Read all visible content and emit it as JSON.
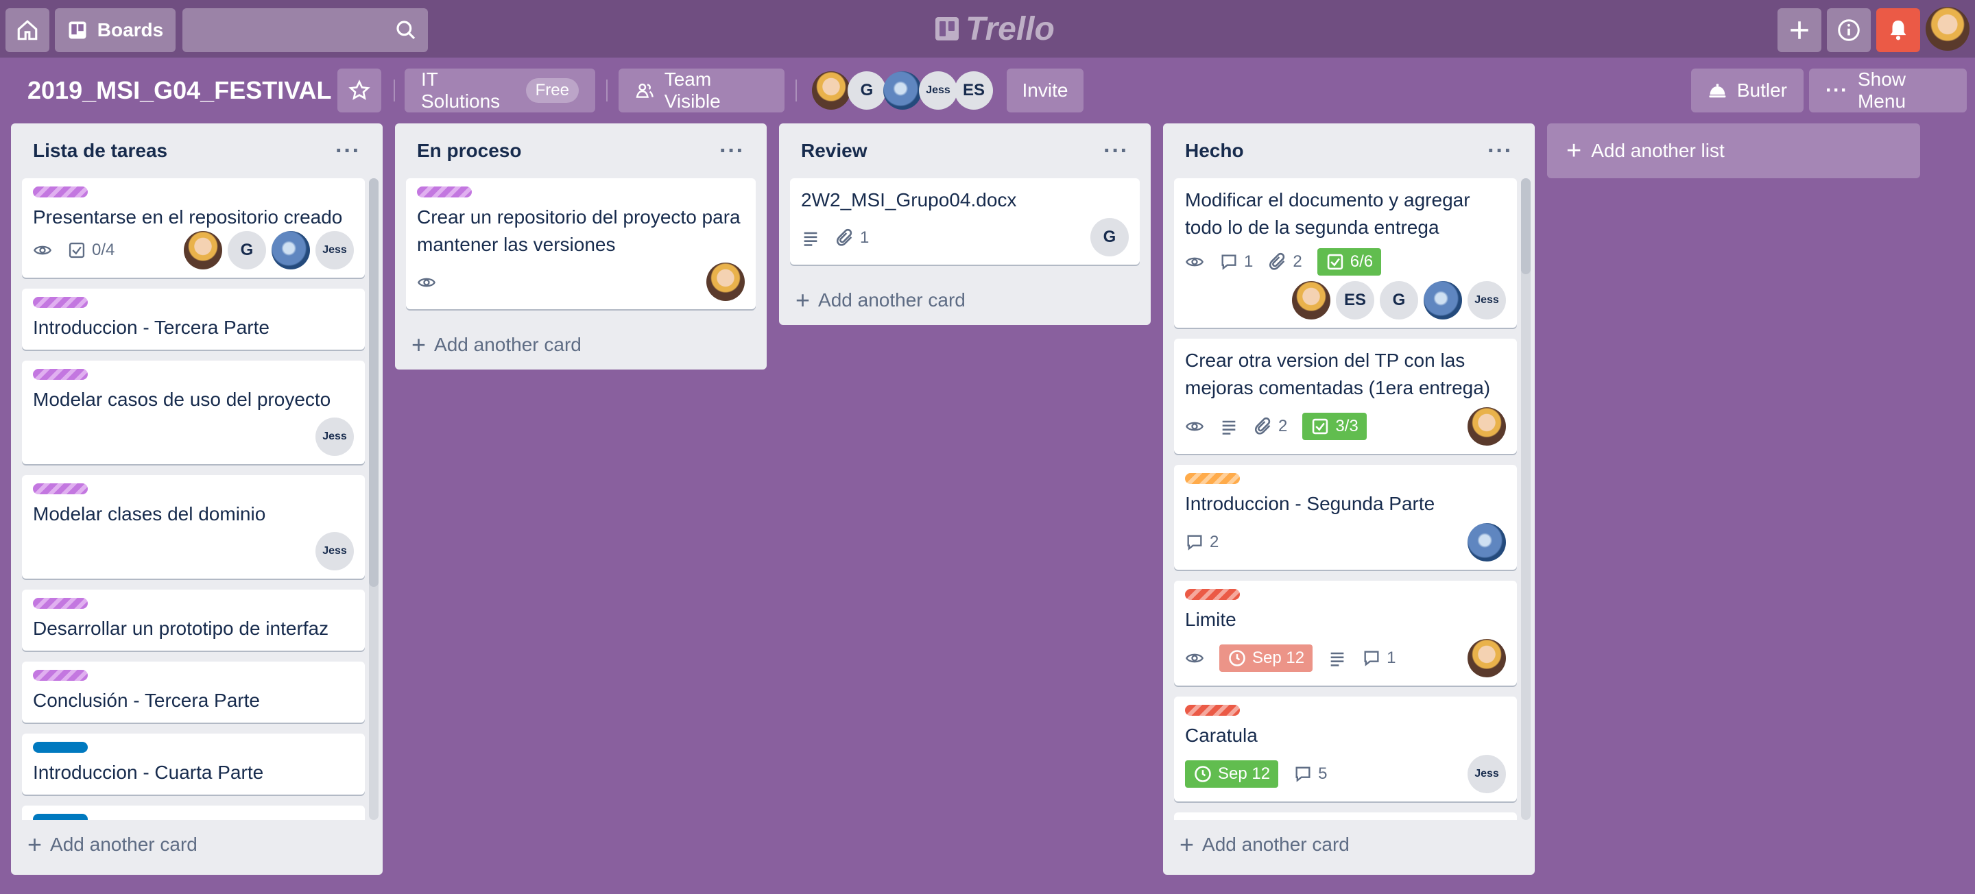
{
  "header": {
    "boards_label": "Boards",
    "search_placeholder": "",
    "logo_text": "Trello"
  },
  "board": {
    "title": "2019_MSI_G04_FESTIVAL",
    "team_name": "IT Solutions",
    "team_plan": "Free",
    "visibility": "Team Visible",
    "invite_label": "Invite",
    "butler_label": "Butler",
    "show_menu_label": "Show Menu",
    "member_initials": [
      "G",
      "Jess",
      "ES"
    ]
  },
  "lists": [
    {
      "title": "Lista de tareas",
      "menu": "···",
      "add_card": "Add another card",
      "cards": [
        {
          "title": "Presentarse en el repositorio creado",
          "label": "purple",
          "watch": true,
          "checklist": "0/4",
          "members": [
            "photo1",
            "G",
            "photo2",
            "Jess"
          ]
        },
        {
          "title": "Introduccion - Tercera Parte",
          "label": "purple"
        },
        {
          "title": "Modelar casos de uso del proyecto",
          "label": "purple",
          "members": [
            "Jess"
          ]
        },
        {
          "title": "Modelar clases del dominio",
          "label": "purple",
          "members": [
            "Jess"
          ]
        },
        {
          "title": "Desarrollar un prototipo de interfaz",
          "label": "purple"
        },
        {
          "title": "Conclusión - Tercera Parte",
          "label": "purple"
        },
        {
          "title": "Introduccion - Cuarta Parte",
          "label": "blue"
        }
      ]
    },
    {
      "title": "En proceso",
      "menu": "···",
      "add_card": "Add another card",
      "cards": [
        {
          "title": "Crear un repositorio del proyecto para mantener las versiones",
          "label": "purple",
          "watch": true,
          "members": [
            "photo1"
          ]
        }
      ]
    },
    {
      "title": "Review",
      "menu": "···",
      "add_card": "Add another card",
      "cards": [
        {
          "title": "2W2_MSI_Grupo04.docx",
          "description": true,
          "attachments": "1",
          "members": [
            "G"
          ]
        }
      ]
    },
    {
      "title": "Hecho",
      "menu": "···",
      "add_card": "Add another card",
      "cards": [
        {
          "title": "Modificar el documento y agregar todo lo de la segunda entrega",
          "watch": true,
          "comments": "1",
          "attachments": "2",
          "checklist": "6/6",
          "members": [
            "photo1",
            "ES",
            "G",
            "photo2",
            "Jess"
          ]
        },
        {
          "title": "Crear otra version del TP con las mejoras comentadas (1era entrega)",
          "watch": true,
          "description": true,
          "attachments": "2",
          "checklist": "3/3",
          "members": [
            "photo1"
          ]
        },
        {
          "title": "Introduccion - Segunda Parte",
          "label": "orange",
          "comments": "2",
          "members": [
            "photo2"
          ]
        },
        {
          "title": "Limite",
          "label": "red",
          "watch": true,
          "due": "Sep 12",
          "description": true,
          "comments": "1",
          "members": [
            "photo1"
          ]
        },
        {
          "title": "Caratula",
          "label": "red",
          "due": "Sep 12",
          "comments": "5",
          "members": [
            "Jess"
          ]
        }
      ]
    }
  ],
  "add_list_label": "Add another list"
}
